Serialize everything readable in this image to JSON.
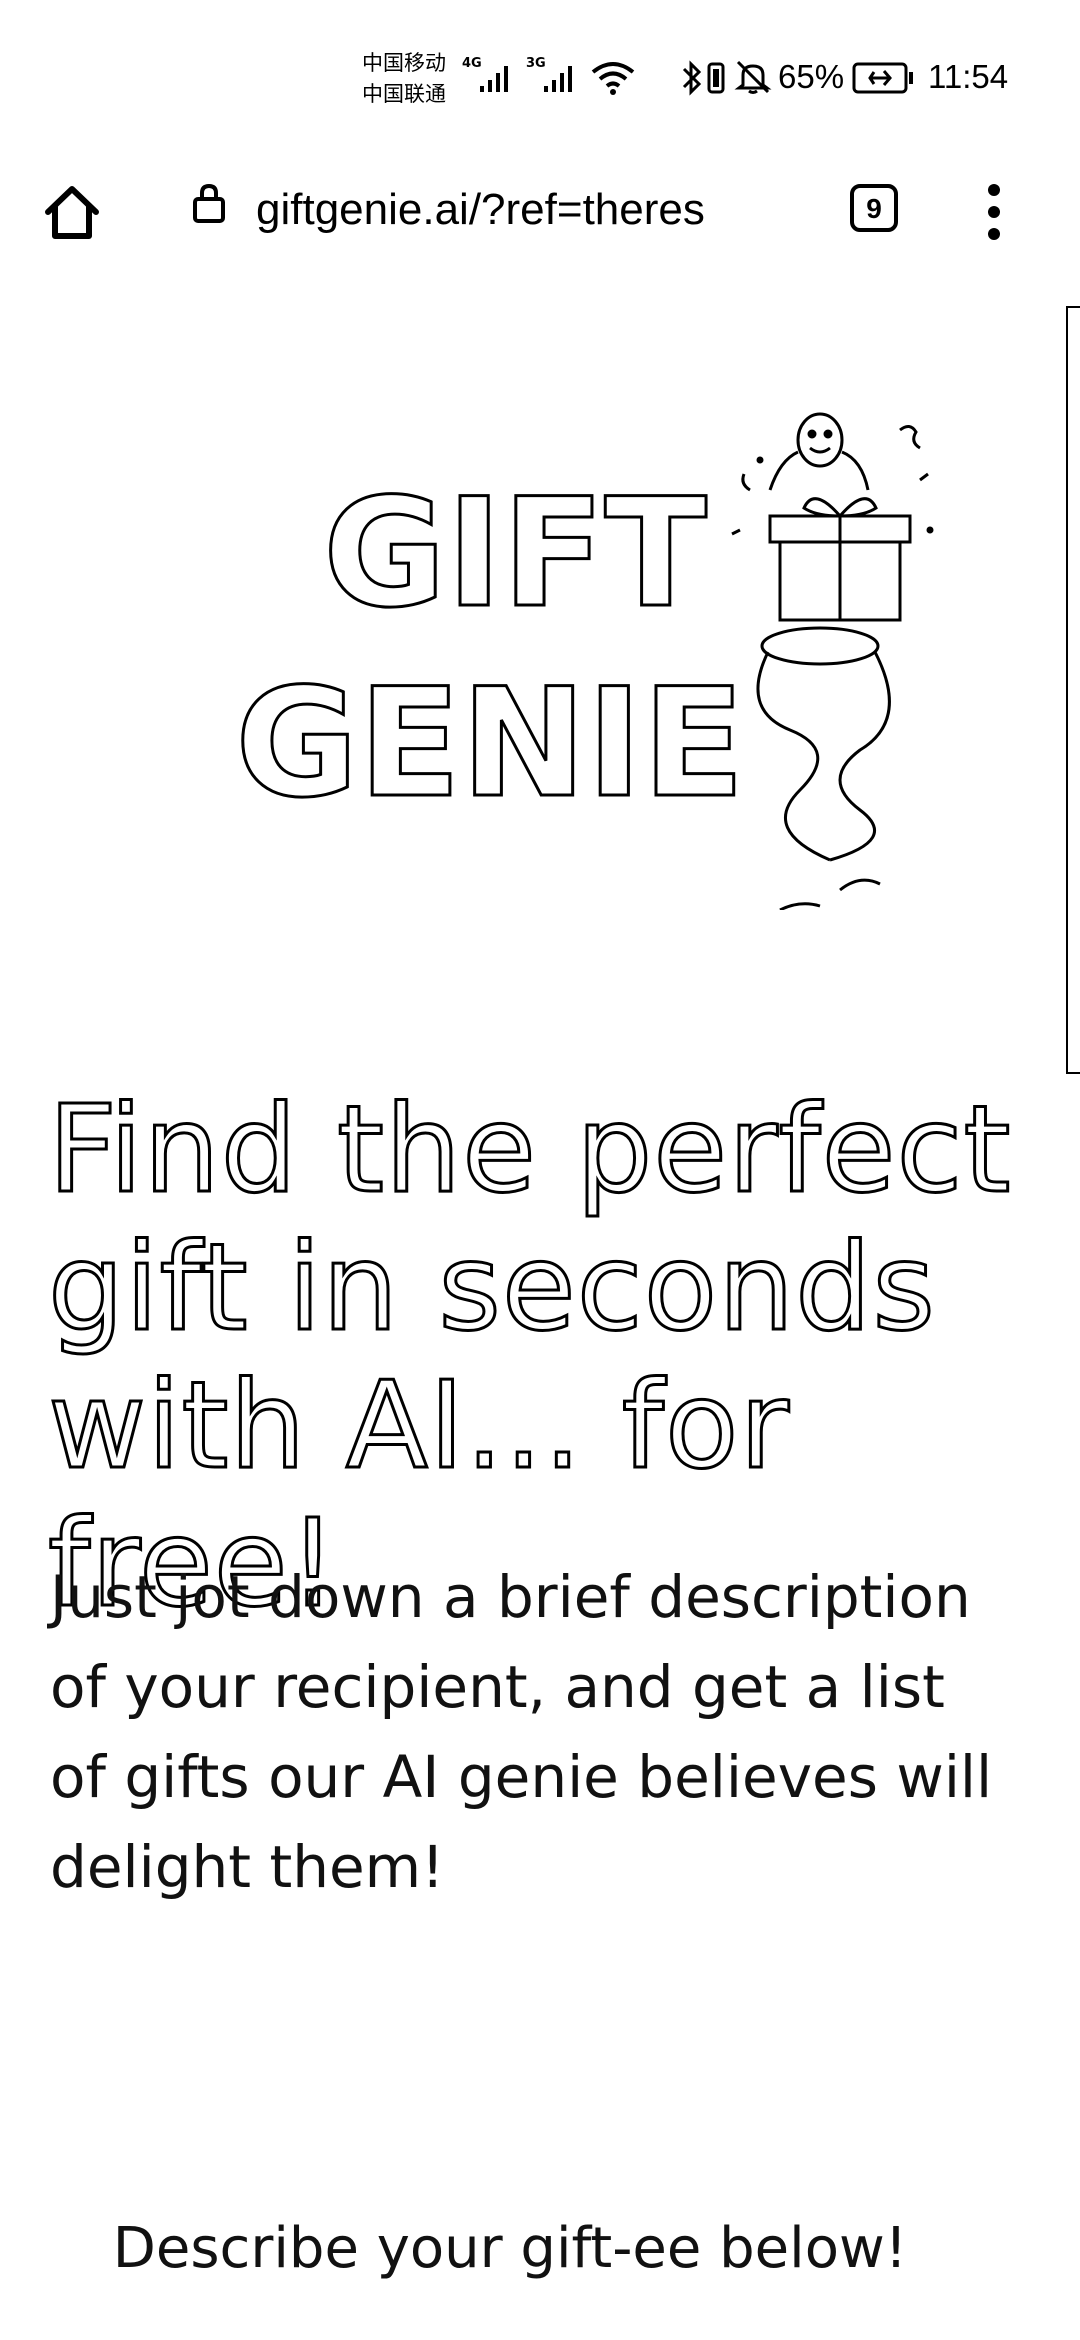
{
  "status_bar": {
    "carrier_1": "中国移动",
    "carrier_2": "中国联通",
    "network_1": "4G",
    "network_2": "3G",
    "icons": [
      "signal-icon",
      "wifi-icon",
      "bluetooth-icon",
      "vibrate-icon",
      "mute-icon",
      "battery-icon"
    ],
    "battery_percent": "65%",
    "time": "11:54"
  },
  "browser": {
    "url": "giftgenie.ai/?ref=theres",
    "tab_count": "9",
    "icons": [
      "home-icon",
      "lock-icon",
      "menu-icon"
    ]
  },
  "page": {
    "logo_line_1": "GIFT",
    "logo_line_2": "GENIE",
    "headline": "Find the perfect gift in seconds with AI... for free!",
    "description": "Just jot down a brief description of your recipient, and get a list of gifts our AI genie believes will delight them!",
    "cta": "Describe your gift-ee below!"
  }
}
